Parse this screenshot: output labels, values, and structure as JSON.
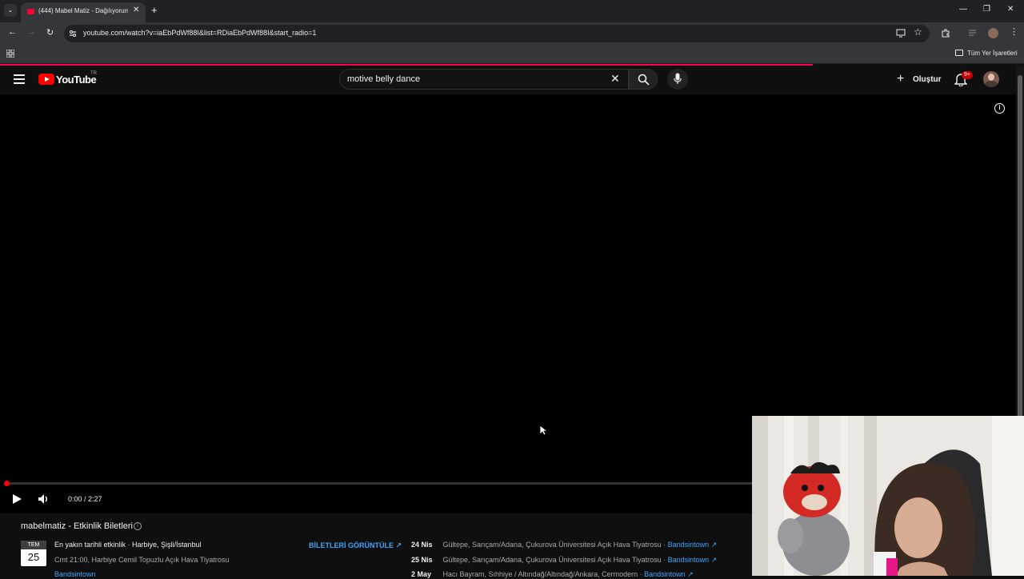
{
  "browser": {
    "tab_title": "(444) Mabel Matiz - Dağılıyorum",
    "tab_new": "+",
    "tab_close": "✕",
    "tab_list": "⌄",
    "url": "youtube.com/watch?v=iaEbPdWf88I&list=RDiaEbPdWf88I&start_radio=1",
    "bookmarks_all": "Tüm Yer İşaretleri",
    "window_min": "—",
    "window_max": "❐",
    "window_close": "✕"
  },
  "youtube": {
    "logo_text": "YouTube",
    "region": "TR",
    "search_value": "motive belly dance",
    "create_label": "Oluştur",
    "create_plus": "+",
    "notif_badge": "9+",
    "search_clear": "✕"
  },
  "player": {
    "time": "0:00 / 2:27",
    "progress_fraction": 0,
    "info": "i"
  },
  "events": {
    "title": "mabelmatiz - Etkinlik Biletleri",
    "next": {
      "month": "TEM",
      "day": "25",
      "main": "En yakın tarihli etkinlik · Harbiye, Şişli/İstanbul",
      "sub": "Cmt 21:00, Harbiye Cemil Topuzlu Açık Hava Tiyatrosu",
      "source": "Bandsintown",
      "button": "BİLETLERİ GÖRÜNTÜLE ↗"
    },
    "list": [
      {
        "date": "24 Nis",
        "venue": "Gültepe, Sarıçam/Adana, Çukurova Üniversitesi Açık Hava Tiyatrosu",
        "source": "· Bandsintown ↗"
      },
      {
        "date": "25 Nis",
        "venue": "Gültepe, Sarıçam/Adana, Çukurova Üniversitesi Açık Hava Tiyatrosu",
        "source": "· Bandsintown ↗"
      },
      {
        "date": "2 May",
        "venue": "Hacı Bayram, Sıhhiye / Altındağ/Altındağ/Ankara, Cermodern",
        "source": "· Bandsintown ↗"
      }
    ]
  },
  "colors": {
    "accent_red": "#ff0000",
    "link_blue": "#3ea6ff",
    "loading_bar": "#ff0050"
  }
}
